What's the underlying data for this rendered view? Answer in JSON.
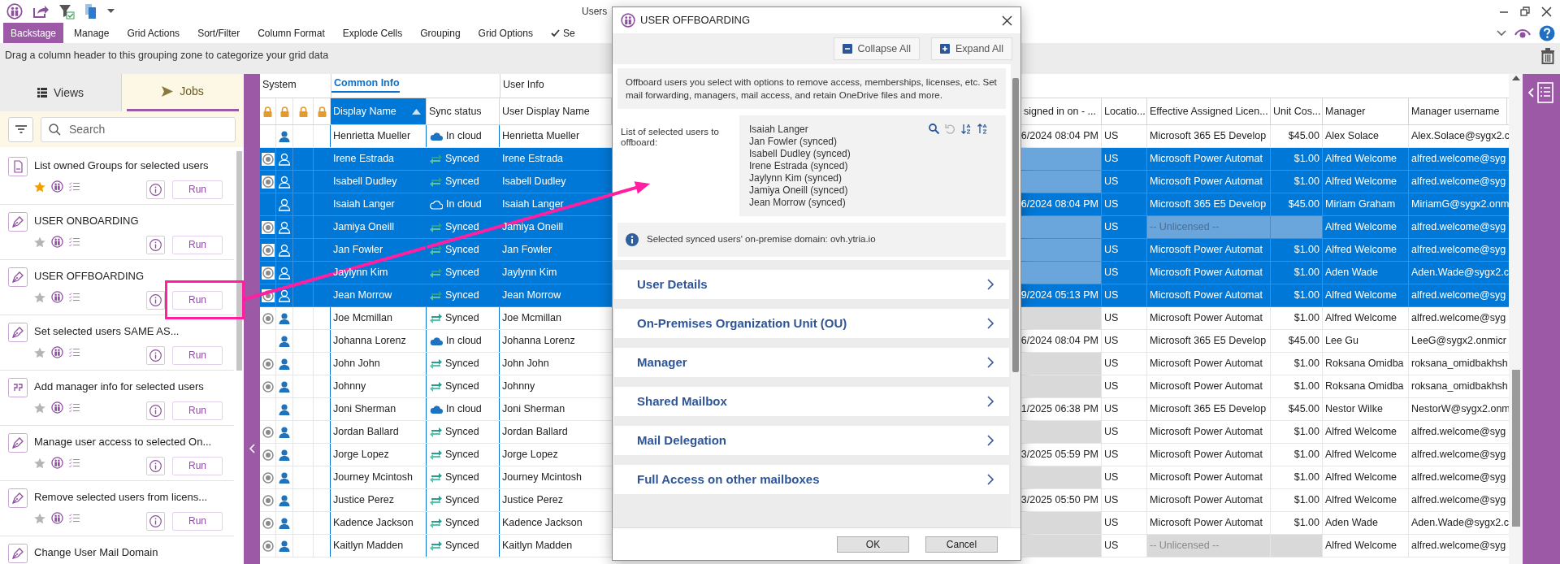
{
  "window": {
    "title": "Users"
  },
  "ribbon": [
    {
      "label": "Backstage",
      "selected": true,
      "checked": false
    },
    {
      "label": "Manage",
      "selected": false,
      "checked": false
    },
    {
      "label": "Grid Actions",
      "selected": false,
      "checked": false
    },
    {
      "label": "Sort/Filter",
      "selected": false,
      "checked": false
    },
    {
      "label": "Column Format",
      "selected": false,
      "checked": false
    },
    {
      "label": "Explode Cells",
      "selected": false,
      "checked": false
    },
    {
      "label": "Grouping",
      "selected": false,
      "checked": false
    },
    {
      "label": "Grid Options",
      "selected": false,
      "checked": false
    },
    {
      "label": "Se",
      "selected": false,
      "checked": true
    }
  ],
  "grouping_zone": {
    "hint": "Drag a column header to this grouping zone to categorize your grid data"
  },
  "side_panel": {
    "tabs": [
      {
        "label": "Views",
        "selected": false
      },
      {
        "label": "Jobs",
        "selected": true
      }
    ],
    "search": {
      "placeholder": "Search"
    },
    "jobs": [
      {
        "title": "List owned Groups for selected users",
        "kind": "document",
        "favorite": true,
        "run_label": "Run"
      },
      {
        "title": "USER ONBOARDING",
        "kind": "script",
        "favorite": false,
        "run_label": "Run"
      },
      {
        "title": "USER OFFBOARDING",
        "kind": "script",
        "favorite": false,
        "run_label": "Run"
      },
      {
        "title": "Set selected users SAME AS...",
        "kind": "script",
        "favorite": false,
        "run_label": "Run"
      },
      {
        "title": "Add manager info for selected users",
        "kind": "quote",
        "favorite": false,
        "run_label": "Run"
      },
      {
        "title": "Manage user access to selected On...",
        "kind": "script",
        "favorite": false,
        "run_label": "Run"
      },
      {
        "title": "Remove selected users from licens...",
        "kind": "script",
        "favorite": false,
        "run_label": "Run"
      },
      {
        "title": "Change User Mail Domain",
        "kind": "script"
      }
    ]
  },
  "grid": {
    "groups": [
      {
        "label": "System",
        "active": false
      },
      {
        "label": "Common Info",
        "active": true
      },
      {
        "label": "User Info",
        "active": false
      }
    ],
    "columns": [
      {
        "label": "Display Name",
        "sorted": true
      },
      {
        "label": "Sync status",
        "sorted": false
      },
      {
        "label": "User Display Name",
        "sorted": false
      },
      {
        "label": "signed in on - ...",
        "sorted": false
      },
      {
        "label": "Locatio...",
        "sorted": false
      },
      {
        "label": "Effective Assigned Licen...",
        "sorted": false
      },
      {
        "label": "Unit Cos...",
        "sorted": false
      },
      {
        "label": "Manager",
        "sorted": false
      },
      {
        "label": "Manager username",
        "sorted": false
      }
    ],
    "rows": [
      {
        "selected": false,
        "on_premises": false,
        "display_name": "Henrietta Mueller",
        "sync": {
          "kind": "cloud",
          "label": "In cloud"
        },
        "user_display_name": "Henrietta Mueller",
        "last_sign_in": "6/2024 08:04 PM",
        "location": "US",
        "license": "Microsoft 365 E5 Develop",
        "licensed": true,
        "unit_cost": "$45.00",
        "manager": "Alex Solace",
        "manager_username": "Alex.Solace@sygx2.c"
      },
      {
        "selected": true,
        "on_premises": true,
        "display_name": "Irene Estrada",
        "sync": {
          "kind": "synced",
          "label": "Synced"
        },
        "user_display_name": "Irene Estrada",
        "location": "US",
        "license": "Microsoft Power Automat",
        "licensed": true,
        "unit_cost": "$1.00",
        "manager": "Alfred Welcome",
        "manager_username": "alfred.welcome@syg"
      },
      {
        "selected": true,
        "on_premises": true,
        "display_name": "Isabell Dudley",
        "sync": {
          "kind": "synced",
          "label": "Synced"
        },
        "user_display_name": "Isabell Dudley",
        "location": "US",
        "license": "Microsoft Power Automat",
        "licensed": true,
        "unit_cost": "$1.00",
        "manager": "Alfred Welcome",
        "manager_username": "alfred.welcome@syg"
      },
      {
        "selected": true,
        "on_premises": false,
        "display_name": "Isaiah Langer",
        "sync": {
          "kind": "cloud",
          "label": "In cloud"
        },
        "user_display_name": "Isaiah Langer",
        "last_sign_in": "6/2024 08:04 PM",
        "location": "US",
        "license": "Microsoft 365 E5 Develop",
        "licensed": true,
        "unit_cost": "$45.00",
        "manager": "Miriam Graham",
        "manager_username": "MiriamG@sygx2.onm"
      },
      {
        "selected": true,
        "on_premises": true,
        "display_name": "Jamiya Oneill",
        "sync": {
          "kind": "synced",
          "label": "Synced"
        },
        "user_display_name": "Jamiya Oneill",
        "location": "US",
        "license": "-- Unlicensed --",
        "licensed": false,
        "manager": "Alfred Welcome",
        "manager_username": "alfred.welcome@syg"
      },
      {
        "selected": true,
        "on_premises": true,
        "display_name": "Jan Fowler",
        "sync": {
          "kind": "synced",
          "label": "Synced"
        },
        "user_display_name": "Jan Fowler",
        "location": "US",
        "license": "Microsoft Power Automat",
        "licensed": true,
        "unit_cost": "$1.00",
        "manager": "Alfred Welcome",
        "manager_username": "alfred.welcome@syg"
      },
      {
        "selected": true,
        "on_premises": true,
        "display_name": "Jaylynn Kim",
        "sync": {
          "kind": "synced",
          "label": "Synced"
        },
        "user_display_name": "Jaylynn Kim",
        "location": "US",
        "license": "Microsoft Power Automat",
        "licensed": true,
        "unit_cost": "$1.00",
        "manager": "Aden Wade",
        "manager_username": "Aden.Wade@sygx2.c"
      },
      {
        "selected": true,
        "on_premises": true,
        "display_name": "Jean Morrow",
        "sync": {
          "kind": "synced",
          "label": "Synced"
        },
        "user_display_name": "Jean Morrow",
        "last_sign_in": "9/2024 05:13 PM",
        "location": "US",
        "license": "Microsoft Power Automat",
        "licensed": true,
        "unit_cost": "$1.00",
        "manager": "Alfred Welcome",
        "manager_username": "alfred.welcome@syg"
      },
      {
        "selected": false,
        "on_premises": true,
        "display_name": "Joe Mcmillan",
        "sync": {
          "kind": "synced",
          "label": "Synced"
        },
        "user_display_name": "Joe Mcmillan",
        "location": "US",
        "license": "Microsoft Power Automat",
        "licensed": true,
        "unit_cost": "$1.00",
        "manager": "Alfred Welcome",
        "manager_username": "alfred.welcome@syg"
      },
      {
        "selected": false,
        "on_premises": false,
        "display_name": "Johanna Lorenz",
        "sync": {
          "kind": "cloud",
          "label": "In cloud"
        },
        "user_display_name": "Johanna Lorenz",
        "last_sign_in": "6/2024 08:04 PM",
        "location": "US",
        "license": "Microsoft 365 E5 Develop",
        "licensed": true,
        "unit_cost": "$45.00",
        "manager": "Lee Gu",
        "manager_username": "LeeG@sygx2.onmicr"
      },
      {
        "selected": false,
        "on_premises": true,
        "display_name": "John John",
        "sync": {
          "kind": "synced",
          "label": "Synced"
        },
        "user_display_name": "John John",
        "location": "US",
        "license": "Microsoft Power Automat",
        "licensed": true,
        "unit_cost": "$1.00",
        "manager": "Roksana Omidba",
        "manager_username": "roksana_omidbakhsh"
      },
      {
        "selected": false,
        "on_premises": true,
        "display_name": "Johnny",
        "sync": {
          "kind": "synced",
          "label": "Synced"
        },
        "user_display_name": "Johnny",
        "location": "US",
        "license": "Microsoft Power Automat",
        "licensed": true,
        "unit_cost": "$1.00",
        "manager": "Roksana Omidba",
        "manager_username": "roksana_omidbakhsh"
      },
      {
        "selected": false,
        "on_premises": false,
        "display_name": "Joni Sherman",
        "sync": {
          "kind": "cloud",
          "label": "In cloud"
        },
        "user_display_name": "Joni Sherman",
        "last_sign_in": "1/2025 06:38 PM",
        "location": "US",
        "license": "Microsoft 365 E5 Develop",
        "licensed": true,
        "unit_cost": "$45.00",
        "manager": "Nestor Wilke",
        "manager_username": "NestorW@sygx2.onm"
      },
      {
        "selected": false,
        "on_premises": true,
        "display_name": "Jordan Ballard",
        "sync": {
          "kind": "synced",
          "label": "Synced"
        },
        "user_display_name": "Jordan Ballard",
        "location": "US",
        "license": "Microsoft Power Automat",
        "licensed": true,
        "unit_cost": "$1.00",
        "manager": "Alfred Welcome",
        "manager_username": "alfred.welcome@syg"
      },
      {
        "selected": false,
        "on_premises": true,
        "display_name": "Jorge Lopez",
        "sync": {
          "kind": "synced",
          "label": "Synced"
        },
        "user_display_name": "Jorge Lopez",
        "last_sign_in": "3/2025 05:59 PM",
        "location": "US",
        "license": "Microsoft Power Automat",
        "licensed": true,
        "unit_cost": "$1.00",
        "manager": "Alfred Welcome",
        "manager_username": "alfred.welcome@syg"
      },
      {
        "selected": false,
        "on_premises": true,
        "display_name": "Journey Mcintosh",
        "sync": {
          "kind": "synced",
          "label": "Synced"
        },
        "user_display_name": "Journey Mcintosh",
        "location": "US",
        "license": "Microsoft Power Automat",
        "licensed": true,
        "unit_cost": "$1.00",
        "manager": "Alfred Welcome",
        "manager_username": "alfred.welcome@syg"
      },
      {
        "selected": false,
        "on_premises": true,
        "display_name": "Justice Perez",
        "sync": {
          "kind": "synced",
          "label": "Synced"
        },
        "user_display_name": "Justice Perez",
        "last_sign_in": "3/2025 05:50 PM",
        "location": "US",
        "license": "Microsoft Power Automat",
        "licensed": true,
        "unit_cost": "$1.00",
        "manager": "Alfred Welcome",
        "manager_username": "alfred.welcome@syg"
      },
      {
        "selected": false,
        "on_premises": true,
        "display_name": "Kadence Jackson",
        "sync": {
          "kind": "synced",
          "label": "Synced"
        },
        "user_display_name": "Kadence Jackson",
        "location": "US",
        "license": "Microsoft Power Automat",
        "licensed": true,
        "unit_cost": "$1.00",
        "manager": "Aden Wade",
        "manager_username": "Aden.Wade@sygx2.c"
      },
      {
        "selected": false,
        "on_premises": true,
        "display_name": "Kaitlyn Madden",
        "sync": {
          "kind": "synced",
          "label": "Synced"
        },
        "user_display_name": "Kaitlyn Madden",
        "location": "US",
        "license": "-- Unlicensed --",
        "licensed": false,
        "manager": "Alfred Welcome",
        "manager_username": "alfred.welcome@syg"
      }
    ]
  },
  "dialog": {
    "title": "USER OFFBOARDING",
    "toolbar": [
      {
        "label": "Collapse All",
        "kind": "collapse"
      },
      {
        "label": "Expand All",
        "kind": "expand"
      }
    ],
    "description": "Offboard users you select with options to remove access, memberships, licenses, etc. Set mail forwarding, managers, mail access, and retain OneDrive files and more.",
    "selection": {
      "label": "List of selected users to offboard:",
      "users": [
        "Isaiah Langer",
        "Jan Fowler (synced)",
        "Isabell Dudley (synced)",
        "Irene Estrada (synced)",
        "Jaylynn Kim (synced)",
        "Jamiya Oneill (synced)",
        "Jean Morrow (synced)"
      ]
    },
    "info": "Selected synced users' on-premise domain: ovh.ytria.io",
    "sections": [
      {
        "title": "User Details",
        "expanded": false
      },
      {
        "title": "On-Premises Organization Unit (OU)",
        "expanded": false
      },
      {
        "title": "Manager",
        "expanded": false
      },
      {
        "title": "Shared Mailbox",
        "expanded": false
      },
      {
        "title": "Mail Delegation",
        "expanded": false
      },
      {
        "title": "Full Access on other mailboxes",
        "expanded": false
      }
    ],
    "buttons": [
      "OK",
      "Cancel"
    ]
  }
}
